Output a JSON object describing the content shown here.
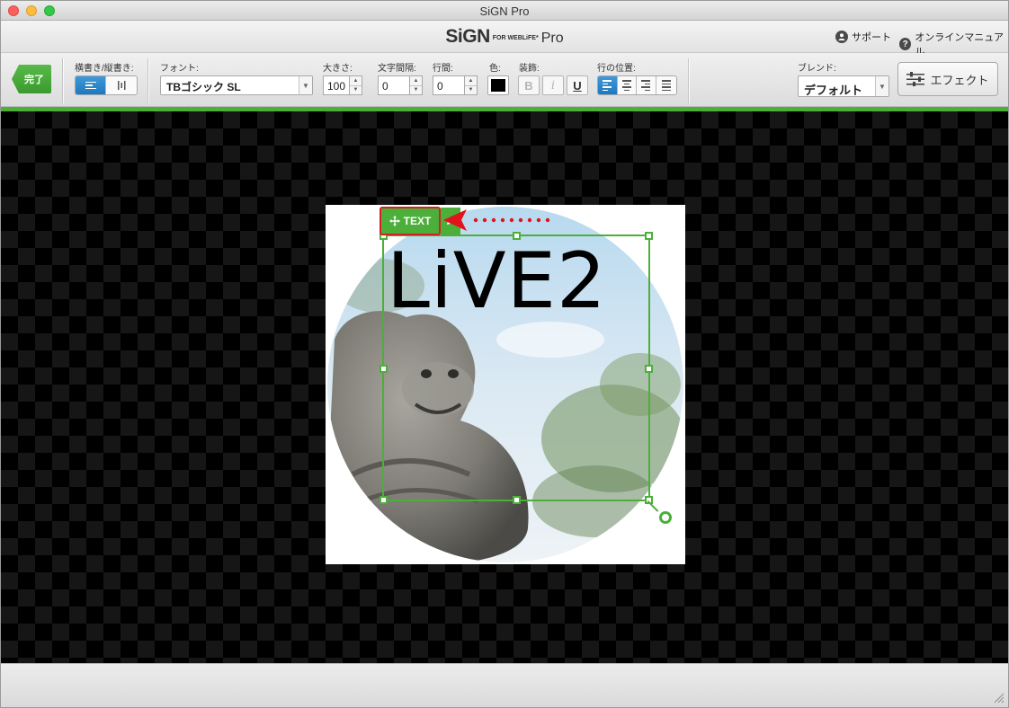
{
  "window": {
    "title": "SiGN Pro"
  },
  "header": {
    "logo_main": "SiGN",
    "logo_sub": "FOR WEBLiFE*",
    "logo_pro": "Pro",
    "support_label": "サポート",
    "manual_label": "オンラインマニュアル"
  },
  "toolbar": {
    "done_label": "完了",
    "orientation_label": "横書き/縦書き:",
    "font_label": "フォント:",
    "font_value": "TBゴシック SL",
    "size_label": "大きさ:",
    "size_value": "100",
    "char_spacing_label": "文字間隔:",
    "char_spacing_value": "0",
    "line_spacing_label": "行間:",
    "line_spacing_value": "0",
    "color_label": "色:",
    "color_value": "#000000",
    "decoration_label": "装飾:",
    "bold_label": "B",
    "italic_label": "i",
    "underline_label": "U",
    "alignment_label": "行の位置:",
    "blend_label": "ブレンド:",
    "blend_value": "デフォルト",
    "effect_label": "エフェクト"
  },
  "canvas": {
    "text_content": "LiVE2",
    "text_tag_label": "TEXT",
    "accent_color": "#4caf3a",
    "highlight_color": "#d71f26"
  }
}
